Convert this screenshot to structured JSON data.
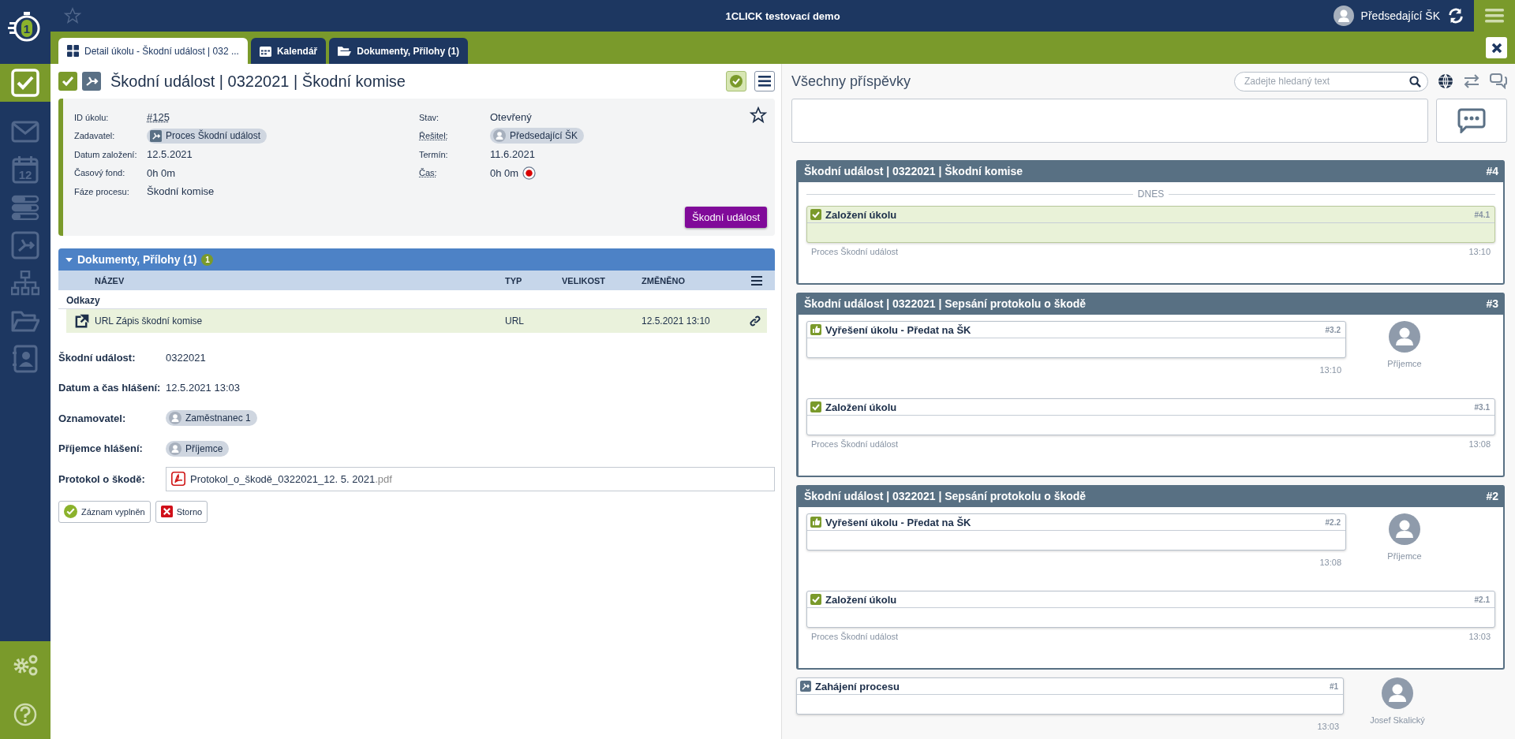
{
  "app": {
    "logo_mark": "1",
    "title": "1CLICK testovací demo",
    "user": "Předsedající ŠK",
    "favorite": false
  },
  "sidebar": {
    "items": [
      {
        "kind": "tasks",
        "selected": true
      },
      {
        "kind": "mail",
        "selected": false
      },
      {
        "kind": "calendar",
        "label": "12",
        "selected": false
      },
      {
        "kind": "list",
        "selected": false
      },
      {
        "kind": "process",
        "selected": false
      },
      {
        "kind": "org",
        "selected": false
      },
      {
        "kind": "folder",
        "selected": false
      },
      {
        "kind": "contacts",
        "selected": false
      }
    ]
  },
  "tabs": [
    {
      "kind": "detail",
      "label": "Detail úkolu - Škodní událost | 032 ...",
      "selected": true
    },
    {
      "kind": "calendar",
      "label": "Kalendář",
      "selected": false
    },
    {
      "kind": "folder",
      "label": "Dokumenty, Přílohy (1)",
      "selected": false
    }
  ],
  "task": {
    "done": true,
    "title": "Škodní událost | 0322021 | Škodní komise",
    "favorite": false,
    "left": [
      {
        "label": "ID úkolu:",
        "kind": "link",
        "value": "#125",
        "hint": false
      },
      {
        "label": "Zadavatel:",
        "kind": "process-chip",
        "value": "Proces Škodní událost",
        "hint": false
      },
      {
        "label": "Datum založení:",
        "kind": "text",
        "value": "12.5.2021",
        "hint": false
      },
      {
        "label": "Časový fond:",
        "kind": "text",
        "value": "0h 0m",
        "hint": false
      },
      {
        "label": "Fáze procesu:",
        "kind": "text",
        "value": "Škodní komise",
        "hint": false
      }
    ],
    "right": [
      {
        "label": "Stav:",
        "kind": "text",
        "value": "Otevřený",
        "hint": false
      },
      {
        "label": "Řešitel:",
        "kind": "person-chip",
        "value": "Předsedající ŠK",
        "hint": true
      },
      {
        "label": "Termín:",
        "kind": "text",
        "value": "11.6.2021",
        "hint": false
      },
      {
        "label": "Čas:",
        "kind": "timer",
        "value": "0h 0m",
        "hint": true
      }
    ],
    "action": "Škodní událost"
  },
  "documents": {
    "title": "Dokumenty, Přílohy (1)",
    "count": "1",
    "expanded": true,
    "columns": [
      "NÁZEV",
      "TYP",
      "VELIKOST",
      "ZMĚNĚNO"
    ],
    "groups": [
      {
        "name": "Odkazy",
        "rows": [
          {
            "name": "URL Zápis škodní komise",
            "type": "URL",
            "changed": "12.5.2021 13:10",
            "selected": true
          }
        ]
      }
    ]
  },
  "form": [
    {
      "label": "Škodní událost:",
      "kind": "text",
      "value": "0322021"
    },
    {
      "label": "Datum a čas hlášení:",
      "kind": "text",
      "value": "12.5.2021 13:03"
    },
    {
      "label": "Oznamovatel:",
      "kind": "person",
      "value": "Zaměstnanec 1"
    },
    {
      "label": "Příjemce hlášení:",
      "kind": "person",
      "value": "Příjemce"
    },
    {
      "label": "Protokol o škodě:",
      "kind": "file",
      "value": "Protokol_o_škodě_0322021_12. 5. 2021",
      "extension": ".pdf"
    }
  ],
  "buttons": [
    {
      "kind": "confirm",
      "label": "Záznam vyplněn"
    },
    {
      "kind": "cancel",
      "label": "Storno"
    }
  ],
  "feed": {
    "title": "Všechny příspěvky",
    "search": {
      "placeholder": "Zadejte hledaný text"
    },
    "items": [
      {
        "kind": "thread",
        "title": "Škodní událost | 0322021 | Škodní komise",
        "number": "#4",
        "divider": "DNES",
        "posts": [
          {
            "kind": "created",
            "title": "Založení úkolu",
            "number": "#4.1",
            "highlighted": true,
            "source": "Proces Škodní událost",
            "time": "13:10"
          }
        ]
      },
      {
        "kind": "thread",
        "title": "Škodní událost | 0322021 | Sepsání protokolu o škodě",
        "number": "#3",
        "posts": [
          {
            "kind": "resolved",
            "title": "Vyřešení úkolu - Předat na ŠK",
            "number": "#3.2",
            "highlighted": false,
            "time": "13:10",
            "author": "Příjemce"
          },
          {
            "kind": "created",
            "title": "Založení úkolu",
            "number": "#3.1",
            "highlighted": false,
            "source": "Proces Škodní událost",
            "time": "13:08"
          }
        ]
      },
      {
        "kind": "thread",
        "title": "Škodní událost | 0322021 | Sepsání protokolu o škodě",
        "number": "#2",
        "posts": [
          {
            "kind": "resolved",
            "title": "Vyřešení úkolu - Předat na ŠK",
            "number": "#2.2",
            "highlighted": false,
            "time": "13:08",
            "author": "Příjemce"
          },
          {
            "kind": "created",
            "title": "Založení úkolu",
            "number": "#2.1",
            "highlighted": false,
            "source": "Proces Škodní událost",
            "time": "13:03"
          }
        ]
      },
      {
        "kind": "post",
        "post": {
          "kind": "process",
          "title": "Zahájení procesu",
          "number": "#1",
          "highlighted": false,
          "time": "13:03",
          "author": "Josef Skalický"
        }
      }
    ]
  }
}
